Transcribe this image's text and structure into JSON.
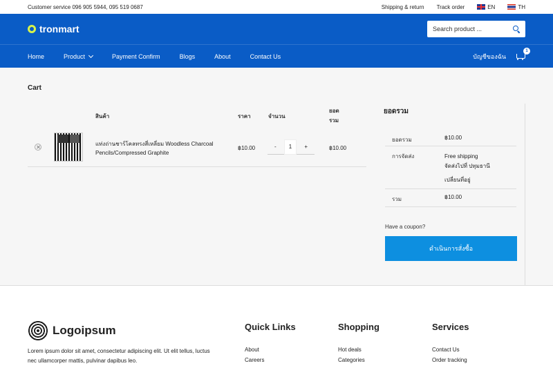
{
  "topbar": {
    "customer_service": "Customer service 096 905 5944, 095 519 0687",
    "shipping": "Shipping & return",
    "track": "Track order",
    "lang_en": "EN",
    "lang_th": "TH"
  },
  "header": {
    "logo_text": "tronmart",
    "search_placeholder": "Search product ..."
  },
  "nav": {
    "items": [
      "Home",
      "Product",
      "Payment Confirm",
      "Blogs",
      "About",
      "Contact Us"
    ],
    "account": "บัญชีของฉัน",
    "cart_count": "1"
  },
  "cart": {
    "title": "Cart",
    "headers": {
      "product": "สินค้า",
      "price": "ราคา",
      "quantity": "จำนวน",
      "subtotal_line1": "ยอด",
      "subtotal_line2": "รวม"
    },
    "item": {
      "name": "แท่งถ่านชาร์โคลทรงสี่เหลี่ยม Woodless Charcoal Pencils/Compressed Graphite",
      "price": "฿10.00",
      "quantity": "1",
      "minus": "-",
      "plus": "+",
      "subtotal": "฿10.00"
    }
  },
  "totals": {
    "title": "ยอดรวม",
    "subtotal_label": "ยอดรวม",
    "subtotal_value": "฿10.00",
    "shipping_label": "การจัดส่ง",
    "shipping_line1": "Free shipping",
    "shipping_line2": "จัดส่งไปที่ ปทุมธานี",
    "shipping_change": "เปลี่ยนที่อยู่",
    "total_label": "รวม",
    "total_value": "฿10.00",
    "coupon": "Have a coupon?",
    "checkout": "ดำเนินการสั่งซื้อ"
  },
  "footer": {
    "logo_text": "Logoipsum",
    "desc": "Lorem ipsum dolor sit amet, consectetur adipiscing elit. Ut elit tellus, luctus nec ullamcorper mattis, pulvinar dapibus leo.",
    "quick_links": {
      "title": "Quick Links",
      "items": [
        "About",
        "Careers"
      ]
    },
    "shopping": {
      "title": "Shopping",
      "items": [
        "Hot deals",
        "Categories"
      ]
    },
    "services": {
      "title": "Services",
      "items": [
        "Contact Us",
        "Order tracking"
      ]
    }
  },
  "colors": {
    "brand_blue": "#0a5cc6",
    "checkout_blue": "#0d8fe0",
    "logo_accent": "#d7f34a"
  }
}
